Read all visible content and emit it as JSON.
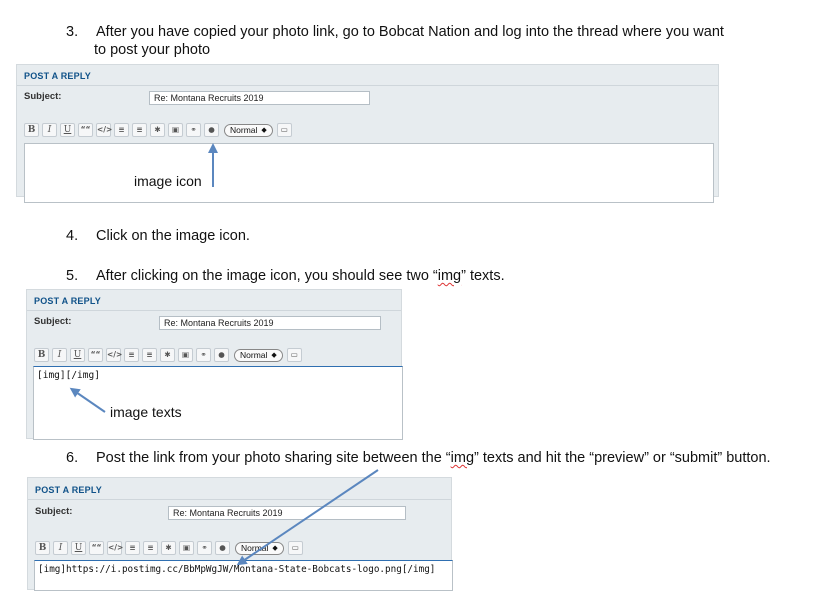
{
  "steps": [
    {
      "num": "3.",
      "line1": "After you have copied your photo link, go to Bobcat Nation and log into the thread where you want",
      "line2": "to post your photo"
    },
    {
      "num": "4.",
      "text": "Click on the image icon."
    },
    {
      "num": "5.",
      "pre": "After clicking on the image icon, you should see two “",
      "squiggle": "img",
      "post": "” texts."
    },
    {
      "num": "6.",
      "pre": "Post the link from your photo sharing site between the “",
      "squiggle": "img",
      "post": "” texts and hit the “preview” or “submit” button."
    }
  ],
  "reply_form": {
    "heading": "POST A REPLY",
    "subject_label": "Subject:",
    "subject_value": "Re: Montana Recruits 2019",
    "font_size": "Normal",
    "toolbar": [
      "B",
      "I",
      "U",
      "““",
      "</>",
      "list-icon",
      "numbered-list-icon",
      "asterisk-icon",
      "image-icon",
      "link-icon",
      "color-icon",
      "preview-icon"
    ]
  },
  "annotations": {
    "image_icon": "image icon",
    "image_texts": "image texts"
  },
  "editor_contents": {
    "panel2": "[img][/img]",
    "panel3": "[img]https://i.postimg.cc/BbMpWgJW/Montana-State-Bobcats-logo.png[/img]"
  },
  "colors": {
    "arrow": "#5b87bf",
    "heading": "#105289",
    "panel_bg": "#e7ecef"
  }
}
